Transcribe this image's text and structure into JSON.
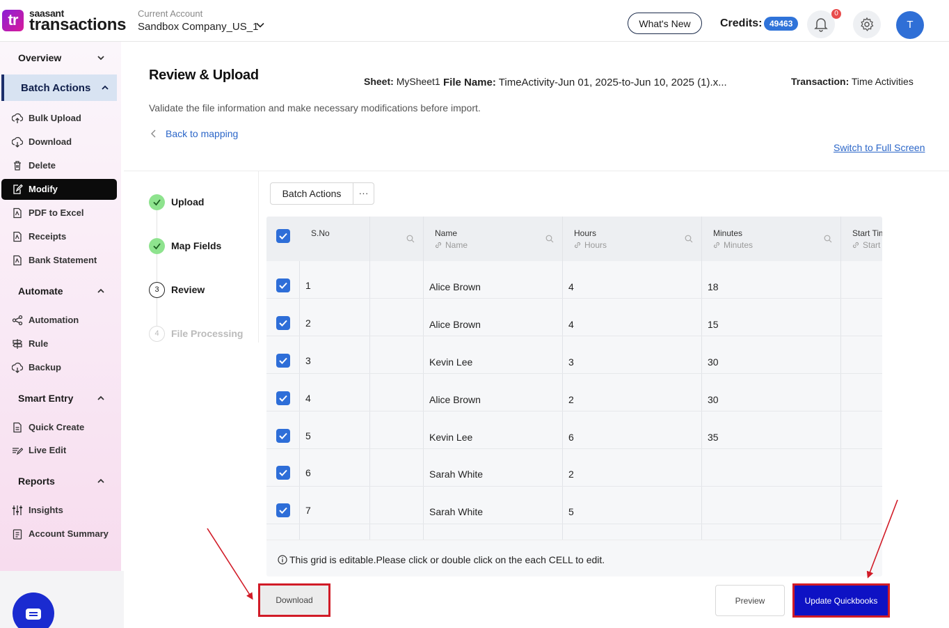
{
  "header": {
    "logo_small": "saasant",
    "logo_big": "transactions",
    "logo_mark": "tr",
    "account_label": "Current Account",
    "account_name": "Sandbox Company_US_1",
    "whats_new": "What's New",
    "credits_label": "Credits:",
    "credits_value": "49463",
    "notification_count": "0",
    "avatar_initial": "T"
  },
  "sidebar": {
    "sections": {
      "overview": "Overview",
      "batch_actions": "Batch Actions",
      "automate": "Automate",
      "smart_entry": "Smart Entry",
      "reports": "Reports"
    },
    "batch_items": [
      {
        "label": "Bulk Upload",
        "icon": "upload-icon"
      },
      {
        "label": "Download",
        "icon": "download-icon"
      },
      {
        "label": "Delete",
        "icon": "trash-icon"
      },
      {
        "label": "Modify",
        "icon": "edit-icon"
      },
      {
        "label": "PDF to Excel",
        "icon": "pdf-icon"
      },
      {
        "label": "Receipts",
        "icon": "receipt-icon"
      },
      {
        "label": "Bank Statement",
        "icon": "bank-statement-icon"
      }
    ],
    "automate_items": [
      {
        "label": "Automation",
        "icon": "share-nodes-icon"
      },
      {
        "label": "Rule",
        "icon": "signpost-icon"
      },
      {
        "label": "Backup",
        "icon": "cloud-backup-icon"
      }
    ],
    "smart_entry_items": [
      {
        "label": "Quick Create",
        "icon": "document-icon"
      },
      {
        "label": "Live Edit",
        "icon": "live-edit-icon"
      }
    ],
    "reports_items": [
      {
        "label": "Insights",
        "icon": "sliders-icon"
      },
      {
        "label": "Account Summary",
        "icon": "summary-icon"
      }
    ]
  },
  "main": {
    "title": "Review & Upload",
    "sheet_label": "Sheet:",
    "sheet_value": "MySheet1",
    "file_label": "File Name:",
    "file_value": "TimeActivity-Jun 01, 2025-to-Jun 10, 2025 (1).x...",
    "transaction_label": "Transaction:",
    "transaction_value": "Time Activities",
    "description": "Validate the file information and make necessary modifications before import.",
    "back_link": "Back to mapping",
    "fullscreen_link": "Switch to Full Screen"
  },
  "steps": [
    {
      "label": "Upload",
      "state": "done"
    },
    {
      "label": "Map Fields",
      "state": "done"
    },
    {
      "label": "Review",
      "state": "current",
      "number": "3"
    },
    {
      "label": "File Processing",
      "state": "pending",
      "number": "4"
    }
  ],
  "toolbar": {
    "batch_actions": "Batch Actions",
    "more": "···"
  },
  "grid": {
    "columns": [
      {
        "label": "S.No",
        "sub": ""
      },
      {
        "label": "",
        "sub": ""
      },
      {
        "label": "Name",
        "sub": "Name"
      },
      {
        "label": "Hours",
        "sub": "Hours"
      },
      {
        "label": "Minutes",
        "sub": "Minutes"
      },
      {
        "label": "Start Time",
        "sub": "Start"
      }
    ],
    "rows": [
      {
        "sno": "1",
        "name": "Alice Brown",
        "hours": "4",
        "minutes": "18"
      },
      {
        "sno": "2",
        "name": "Alice Brown",
        "hours": "4",
        "minutes": "15"
      },
      {
        "sno": "3",
        "name": "Kevin Lee",
        "hours": "3",
        "minutes": "30"
      },
      {
        "sno": "4",
        "name": "Alice Brown",
        "hours": "2",
        "minutes": "30"
      },
      {
        "sno": "5",
        "name": "Kevin Lee",
        "hours": "6",
        "minutes": "35"
      },
      {
        "sno": "6",
        "name": "Sarah White",
        "hours": "2",
        "minutes": ""
      },
      {
        "sno": "7",
        "name": "Sarah White",
        "hours": "5",
        "minutes": ""
      }
    ],
    "note": "This grid is editable.Please click or double click on the each CELL to edit."
  },
  "actions": {
    "download": "Download",
    "preview": "Preview",
    "update": "Update Quickbooks"
  },
  "colors": {
    "accent": "#2e6ed8",
    "primary_button": "#0e12c4",
    "annotation": "#d11b27",
    "step_done": "#8ee38e"
  }
}
